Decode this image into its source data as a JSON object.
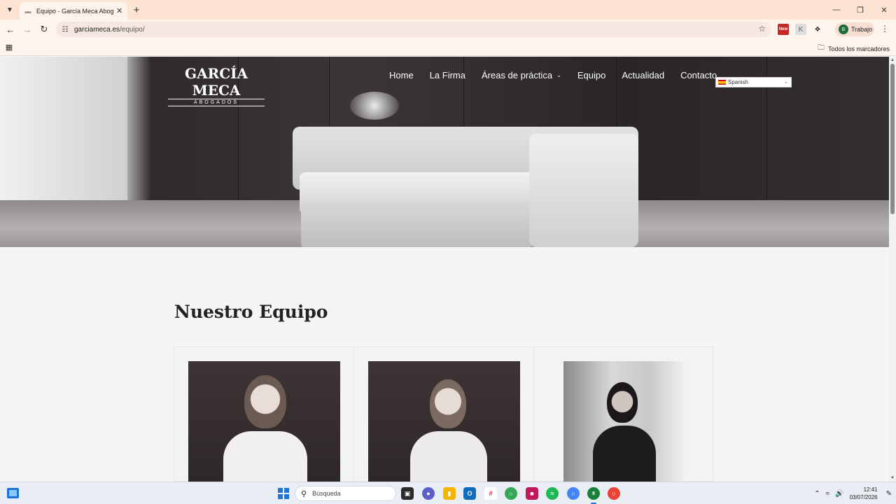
{
  "browser": {
    "tab_title": "Equipo - García Meca Abogados",
    "url_host": "garciameca.es",
    "url_path": "/equipo/",
    "profile_initial": "B",
    "profile_name": "Trabajo",
    "all_bookmarks": "Todos los marcadores",
    "ext_new_label": "New",
    "ext_k_label": "K"
  },
  "site": {
    "logo_main": "GARCÍA MECA",
    "logo_sub": "ABOGADOS",
    "nav": [
      {
        "label": "Home"
      },
      {
        "label": "La Firma"
      },
      {
        "label": "Áreas de práctica"
      },
      {
        "label": "Equipo"
      },
      {
        "label": "Actualidad"
      },
      {
        "label": "Contacto"
      }
    ],
    "language": "Spanish"
  },
  "content": {
    "title": "Nuestro Equipo",
    "members_visible": 3
  },
  "taskbar": {
    "search_placeholder": "Búsqueda",
    "time": "12:41",
    "date": "03/07/2026",
    "badge_count": "8"
  },
  "colors": {
    "tabbar": "#fde3d2",
    "toolbar": "#fdf4ee",
    "page_bg": "#f5f5f5",
    "title_text": "#222222",
    "accent_blue": "#1f76d6"
  }
}
